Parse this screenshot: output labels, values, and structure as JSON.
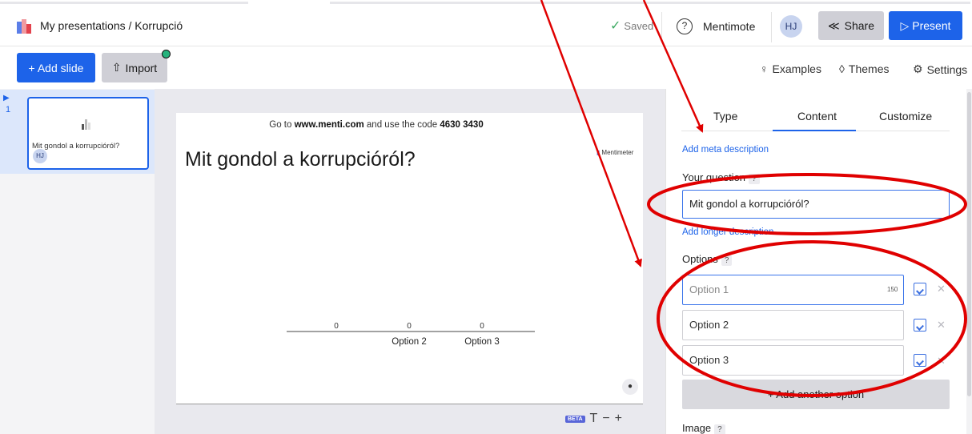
{
  "header": {
    "breadcrumb": "My presentations / Korrupció",
    "saved": "Saved",
    "mentimote": "Mentimote",
    "avatar": "HJ",
    "share": "Share",
    "present": "Present"
  },
  "toolbar": {
    "add_slide": "+ Add slide",
    "import": "Import",
    "examples": "Examples",
    "themes": "Themes",
    "settings": "Settings"
  },
  "sidebar": {
    "slides": [
      {
        "number": "1",
        "title": "Mit gondol a korrupcióról?",
        "avatar": "HJ"
      }
    ]
  },
  "slide": {
    "code_prefix": "Go to ",
    "url": "www.menti.com",
    "code_middle": " and use the code ",
    "code": "4630 3430",
    "title": "Mit gondol a korrupcióról?",
    "brand": "Mentimeter",
    "text_tools": {
      "beta": "BETA",
      "text": "T",
      "minus": "−",
      "plus": "+"
    }
  },
  "chart_data": {
    "type": "bar",
    "categories": [
      "",
      "Option 2",
      "Option 3"
    ],
    "values": [
      0,
      0,
      0
    ]
  },
  "panel": {
    "tabs": [
      "Type",
      "Content",
      "Customize"
    ],
    "active_tab": "Content",
    "meta_link": "Add meta description",
    "question_label": "Your question",
    "qmark": "?",
    "question_value": "Mit gondol a korrupcióról?",
    "longer_link": "Add longer description",
    "options_label": "Options",
    "options": [
      {
        "placeholder": "Option 1",
        "value": ""
      },
      {
        "placeholder": "Option 2",
        "value": "Option 2"
      },
      {
        "placeholder": "Option 3",
        "value": "Option 3"
      }
    ],
    "option1_count": "150",
    "add_option": "+ Add another option",
    "image_label": "Image"
  },
  "colors": {
    "accent": "#1d63e9",
    "annotation": "#e00000"
  }
}
